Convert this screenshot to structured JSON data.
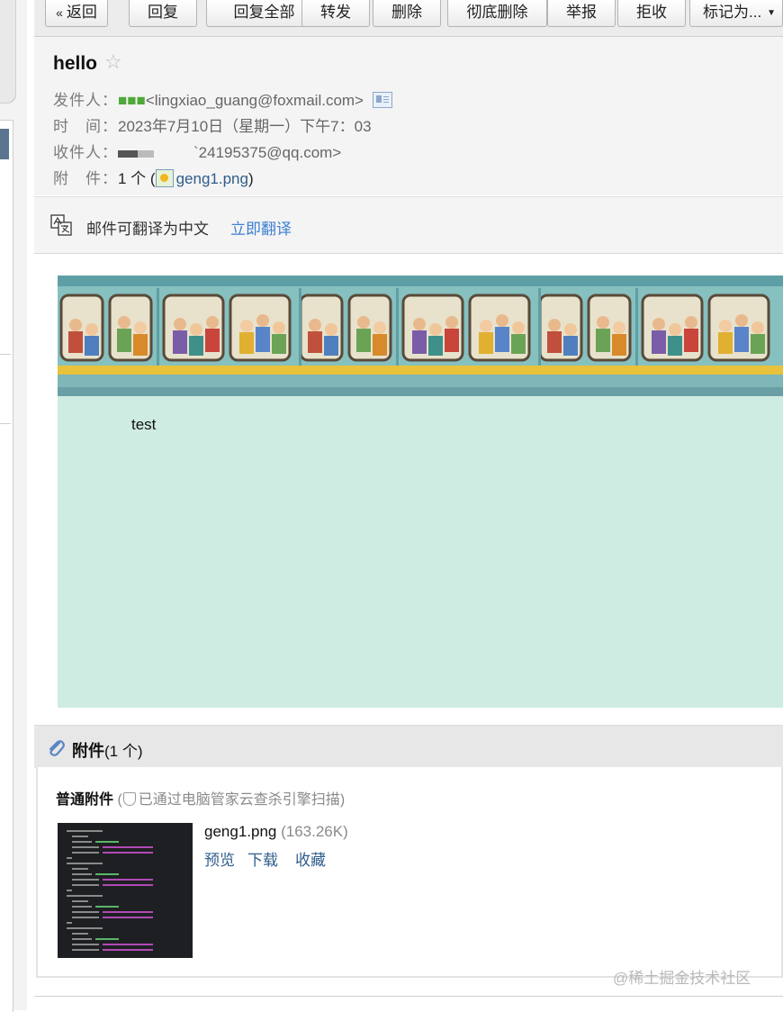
{
  "toolbar": {
    "back_label": "返回",
    "reply_label": "回复",
    "reply_all_label": "回复全部",
    "forward_label": "转发",
    "delete_label": "删除",
    "delete_permanently_label": "彻底删除",
    "report_label": "举报",
    "reject_label": "拒收",
    "mark_as_label": "标记为..."
  },
  "email": {
    "subject": "hello",
    "from_label": "发件人：",
    "from_name": "■■■",
    "from_address": "<lingxiao_guang@foxmail.com>",
    "time_label": "时　间：",
    "time_value": "2023年7月10日（星期一）下午7：03",
    "to_label": "收件人：",
    "to_address": "`24195375@qq.com>",
    "attach_label": "附　件：",
    "attach_count": "1 个",
    "attach_open": " (",
    "attach_file": "geng1.png",
    "attach_close": ")"
  },
  "translate": {
    "text": "邮件可翻译为中文",
    "link": "立即翻译"
  },
  "body": {
    "text": "test",
    "background_color": "#cfece2"
  },
  "attachments": {
    "title": "附件",
    "count": "(1 个)",
    "normal_label": "普通附件",
    "scan_open": " (",
    "scan_note": "已通过电脑管家云查杀引擎扫描",
    "scan_close": ")",
    "file_name": "geng1.png",
    "file_size": "(163.26K)",
    "preview_label": "预览",
    "download_label": "下载",
    "save_label": "收藏"
  },
  "watermark": "@稀土掘金技术社区",
  "colors": {
    "link": "#2f5d8a",
    "translate_link": "#3c7fd2",
    "sender_name": "#4ea83a"
  }
}
